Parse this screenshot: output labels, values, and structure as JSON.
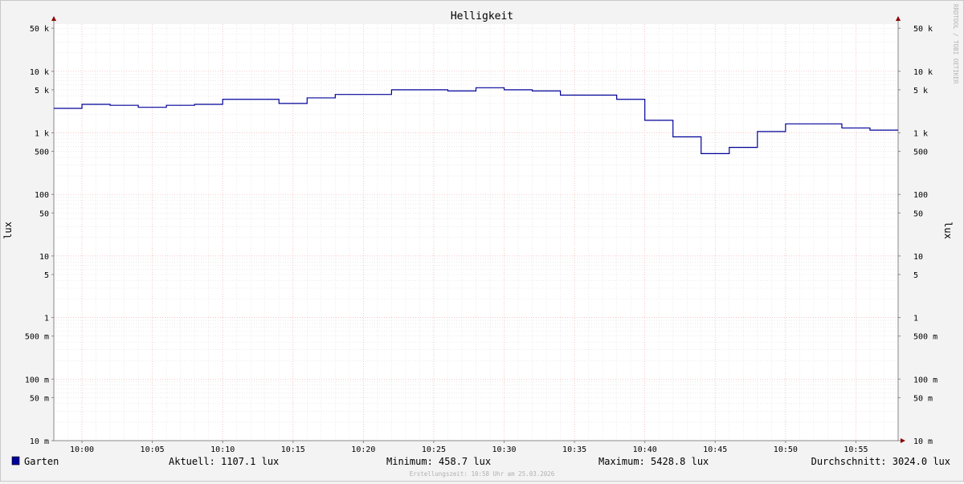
{
  "chart_data": {
    "type": "line",
    "title": "Helligkeit",
    "ylabel_left": "lux",
    "ylabel_right": "lux",
    "y_scale": "log",
    "ylim": [
      0.01,
      100000
    ],
    "y_ticks": [
      {
        "value": 50000,
        "label": "50 k"
      },
      {
        "value": 10000,
        "label": "10 k"
      },
      {
        "value": 5000,
        "label": "5 k"
      },
      {
        "value": 1000,
        "label": "1 k"
      },
      {
        "value": 500,
        "label": "500"
      },
      {
        "value": 100,
        "label": "100"
      },
      {
        "value": 50,
        "label": "50"
      },
      {
        "value": 10,
        "label": "10"
      },
      {
        "value": 5,
        "label": "5"
      },
      {
        "value": 1,
        "label": "1"
      },
      {
        "value": 0.5,
        "label": "500 m"
      },
      {
        "value": 0.1,
        "label": "100 m"
      },
      {
        "value": 0.05,
        "label": "50 m"
      },
      {
        "value": 0.01,
        "label": "10 m"
      }
    ],
    "x_range_minutes": [
      "09:58",
      "10:58"
    ],
    "x_ticks": [
      "10:00",
      "10:05",
      "10:10",
      "10:15",
      "10:20",
      "10:25",
      "10:30",
      "10:35",
      "10:40",
      "10:45",
      "10:50",
      "10:55"
    ],
    "grid": true,
    "series": [
      {
        "name": "Garten",
        "color": "#000099",
        "step": "post",
        "x": [
          "09:58",
          "10:00",
          "10:02",
          "10:04",
          "10:06",
          "10:08",
          "10:10",
          "10:12",
          "10:14",
          "10:16",
          "10:18",
          "10:20",
          "10:22",
          "10:24",
          "10:26",
          "10:28",
          "10:30",
          "10:32",
          "10:34",
          "10:36",
          "10:38",
          "10:40",
          "10:42",
          "10:44",
          "10:46",
          "10:48",
          "10:50",
          "10:52",
          "10:54",
          "10:56",
          "10:58"
        ],
        "y": [
          2500,
          2900,
          2800,
          2600,
          2800,
          2900,
          3500,
          3500,
          3000,
          3700,
          4200,
          4200,
          5000,
          5000,
          4800,
          5400,
          5000,
          4800,
          4100,
          4100,
          3500,
          1600,
          860,
          460,
          580,
          1050,
          1400,
          1400,
          1200,
          1107,
          1107
        ]
      }
    ]
  },
  "legend": {
    "series_name": "Garten",
    "current": "Aktuell: 1107.1 lux",
    "minimum": "Minimum: 458.7 lux",
    "maximum": "Maximum: 5428.8 lux",
    "average": "Durchschnitt: 3024.0 lux"
  },
  "footer": "Erstellungszeit: 10:58 Uhr am 25.03.2026",
  "watermark": "RRDTOOL / TOBI OETIKER",
  "colors": {
    "background": "#f3f3f3",
    "canvas": "#ffffff",
    "grid_minor": "#dedede",
    "grid_major": "#f0b0b0",
    "axis": "#888888",
    "arrow": "#8b0000",
    "line": "#000099"
  }
}
